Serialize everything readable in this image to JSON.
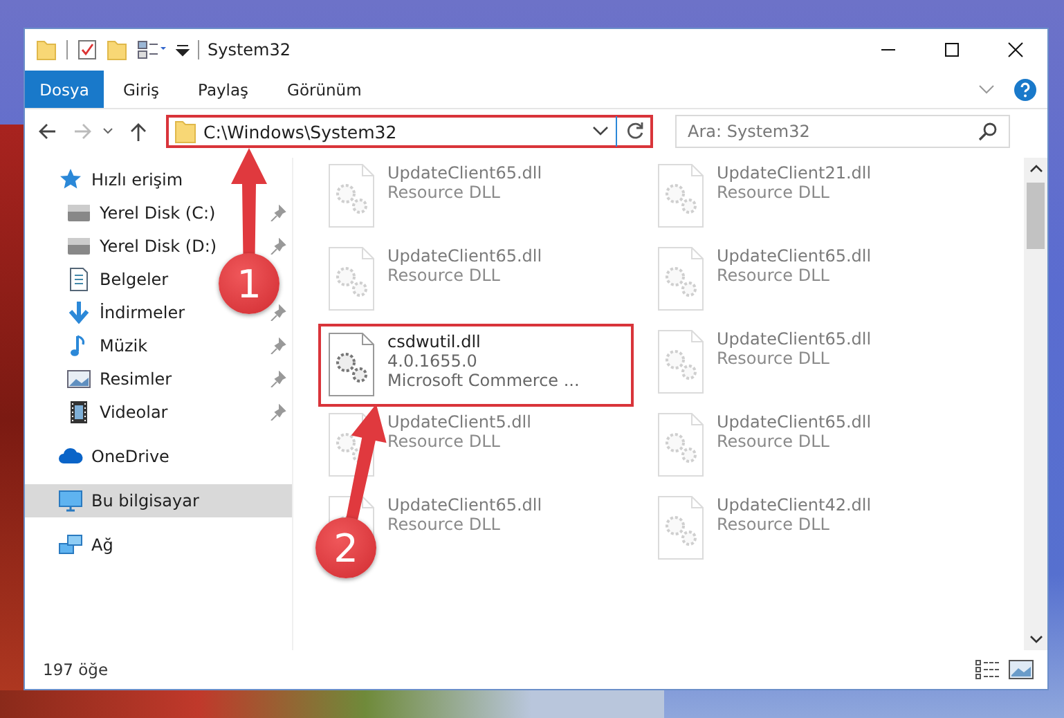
{
  "window": {
    "title": "System32"
  },
  "ribbon_tabs": [
    {
      "label": "Dosya",
      "kind": "file"
    },
    {
      "label": "Giriş",
      "kind": "tab"
    },
    {
      "label": "Paylaş",
      "kind": "tab"
    },
    {
      "label": "Görünüm",
      "kind": "tab"
    }
  ],
  "address": {
    "path": "C:\\Windows\\System32",
    "highlighted": true
  },
  "search": {
    "placeholder": "Ara: System32"
  },
  "sidebar": {
    "items": [
      {
        "label": "Hızlı erişim",
        "kind": "star",
        "selected": false,
        "children": [
          {
            "label": "Yerel Disk (C:)",
            "kind": "drive",
            "pinned": true,
            "selected": false
          },
          {
            "label": "Yerel Disk (D:)",
            "kind": "drive",
            "pinned": true,
            "selected": false
          },
          {
            "label": "Belgeler",
            "kind": "documents",
            "pinned": false,
            "selected": false
          },
          {
            "label": "İndirmeler",
            "kind": "downloads",
            "pinned": true,
            "selected": false
          },
          {
            "label": "Müzik",
            "kind": "music",
            "pinned": true,
            "selected": false
          },
          {
            "label": "Resimler",
            "kind": "pictures",
            "pinned": true,
            "selected": false
          },
          {
            "label": "Videolar",
            "kind": "videos",
            "pinned": true,
            "selected": false
          }
        ]
      },
      {
        "label": "OneDrive",
        "kind": "cloud",
        "selected": false
      },
      {
        "label": "Bu bilgisayar",
        "kind": "computer",
        "selected": true
      },
      {
        "label": "Ağ",
        "kind": "network",
        "selected": false
      }
    ]
  },
  "files": [
    {
      "name": "UpdateClient65.dll",
      "lines": [
        "Resource DLL"
      ],
      "faded": true,
      "highlighted": false
    },
    {
      "name": "UpdateClient21.dll",
      "lines": [
        "Resource DLL"
      ],
      "faded": true,
      "highlighted": false
    },
    {
      "name": "UpdateClient65.dll",
      "lines": [
        "Resource DLL"
      ],
      "faded": true,
      "highlighted": false
    },
    {
      "name": "UpdateClient65.dll",
      "lines": [
        "Resource DLL"
      ],
      "faded": true,
      "highlighted": false
    },
    {
      "name": "csdwutil.dll",
      "lines": [
        "4.0.1655.0",
        "Microsoft Commerce ..."
      ],
      "faded": false,
      "highlighted": true
    },
    {
      "name": "UpdateClient65.dll",
      "lines": [
        "Resource DLL"
      ],
      "faded": true,
      "highlighted": false
    },
    {
      "name": "UpdateClient5.dll",
      "lines": [
        "Resource DLL"
      ],
      "faded": true,
      "highlighted": false
    },
    {
      "name": "UpdateClient65.dll",
      "lines": [
        "Resource DLL"
      ],
      "faded": true,
      "highlighted": false
    },
    {
      "name": "UpdateClient65.dll",
      "lines": [
        "Resource DLL"
      ],
      "faded": true,
      "highlighted": false
    },
    {
      "name": "UpdateClient42.dll",
      "lines": [
        "Resource DLL"
      ],
      "faded": true,
      "highlighted": false
    }
  ],
  "status_bar": {
    "count": "197 öğe"
  },
  "annotations": [
    {
      "number": "1"
    },
    {
      "number": "2"
    }
  ]
}
